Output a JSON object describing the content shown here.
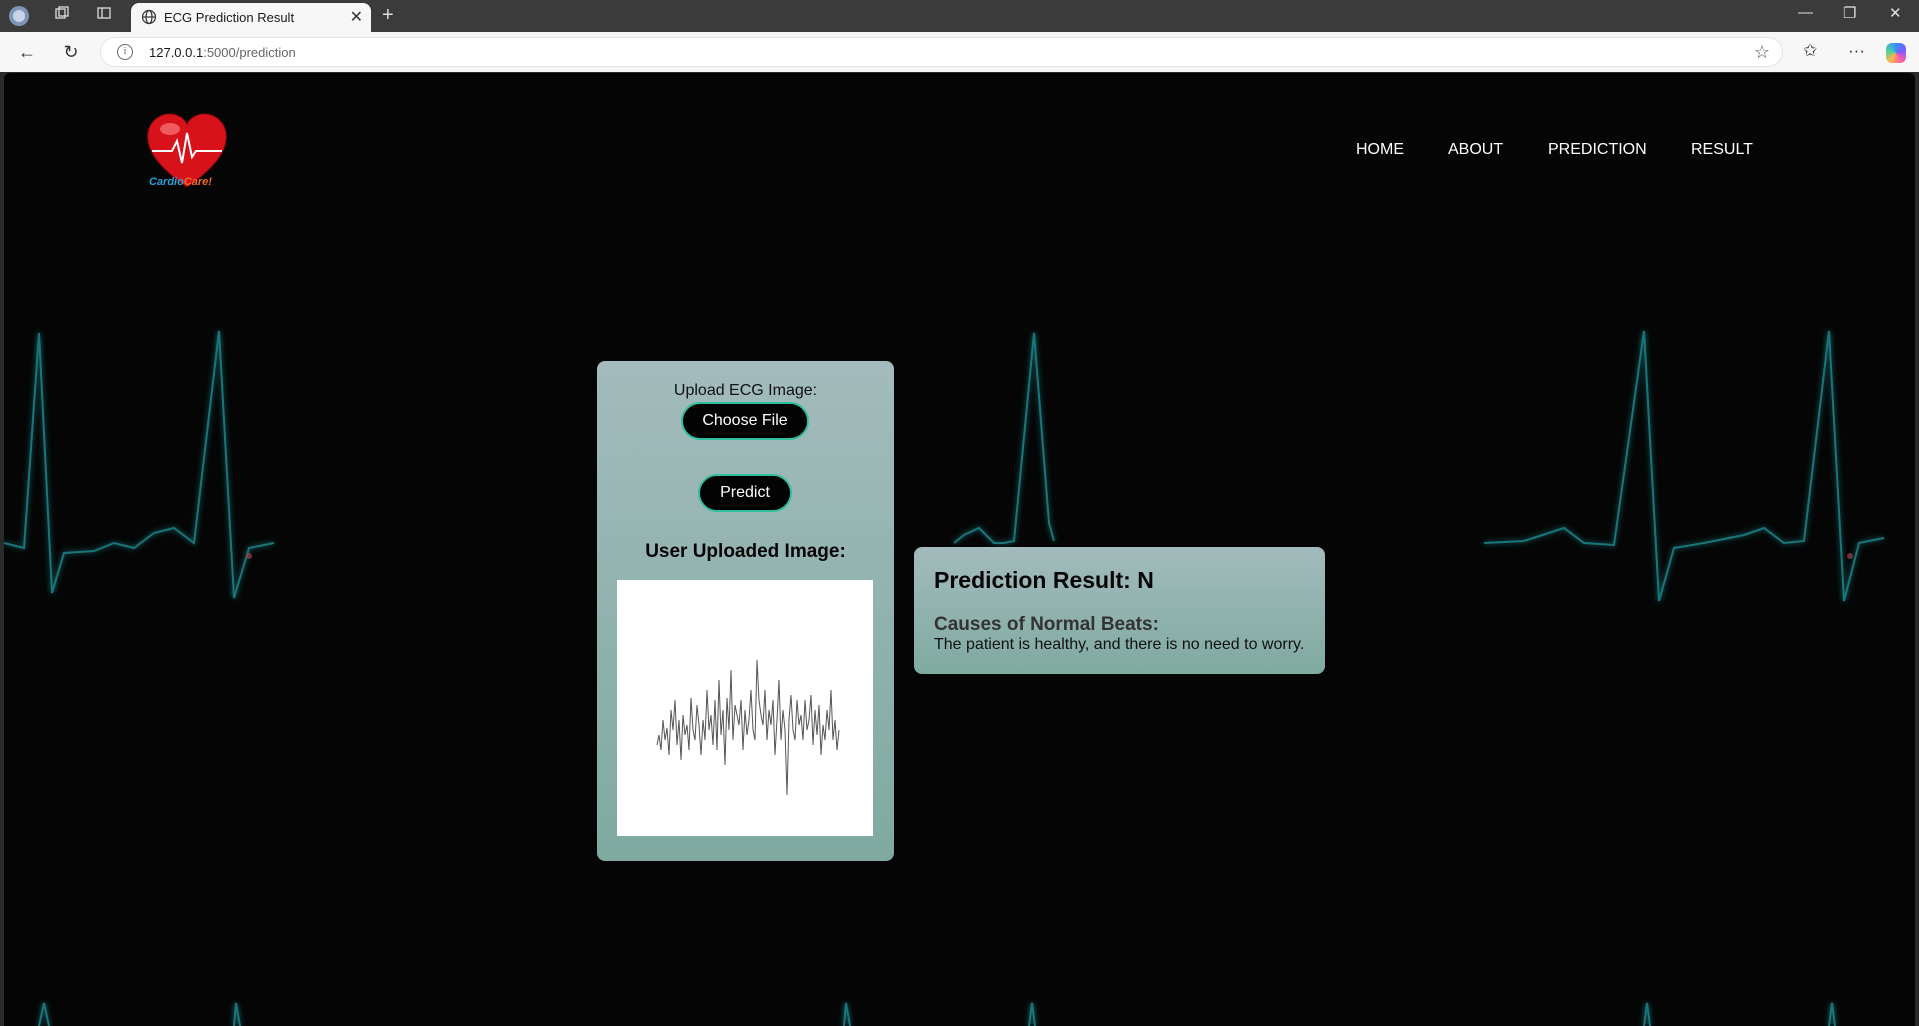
{
  "browser": {
    "tab_title": "ECG Prediction Result",
    "url_host": "127.0.0.1",
    "url_rest": ":5000/prediction",
    "new_tab_symbol": "+",
    "tab_close_symbol": "✕"
  },
  "site": {
    "logo_text_1": "Cardio",
    "logo_text_2": "Care!",
    "nav": {
      "home": "HOME",
      "about": "ABOUT",
      "prediction": "PREDICTION",
      "result": "RESULT"
    }
  },
  "upload": {
    "label": "Upload ECG Image:",
    "choose_file": "Choose File",
    "predict": "Predict",
    "uploaded_title": "User Uploaded Image:"
  },
  "result": {
    "title": "Prediction Result: N",
    "cause_title": "Causes of Normal Beats:",
    "cause_text": "The patient is healthy, and there is no need to worry."
  },
  "colors": {
    "accent": "#2fbf9f",
    "panel_top": "#a3bbbc",
    "panel_bottom": "#7faaa0",
    "ecg_line": "#1e8a8f"
  },
  "icons": [
    "workspace-icon",
    "collections-icon",
    "tab-actions-icon",
    "globe-icon",
    "back-icon",
    "refresh-icon",
    "info-icon",
    "star-icon",
    "favorites-icon",
    "more-icon",
    "copilot-icon"
  ]
}
